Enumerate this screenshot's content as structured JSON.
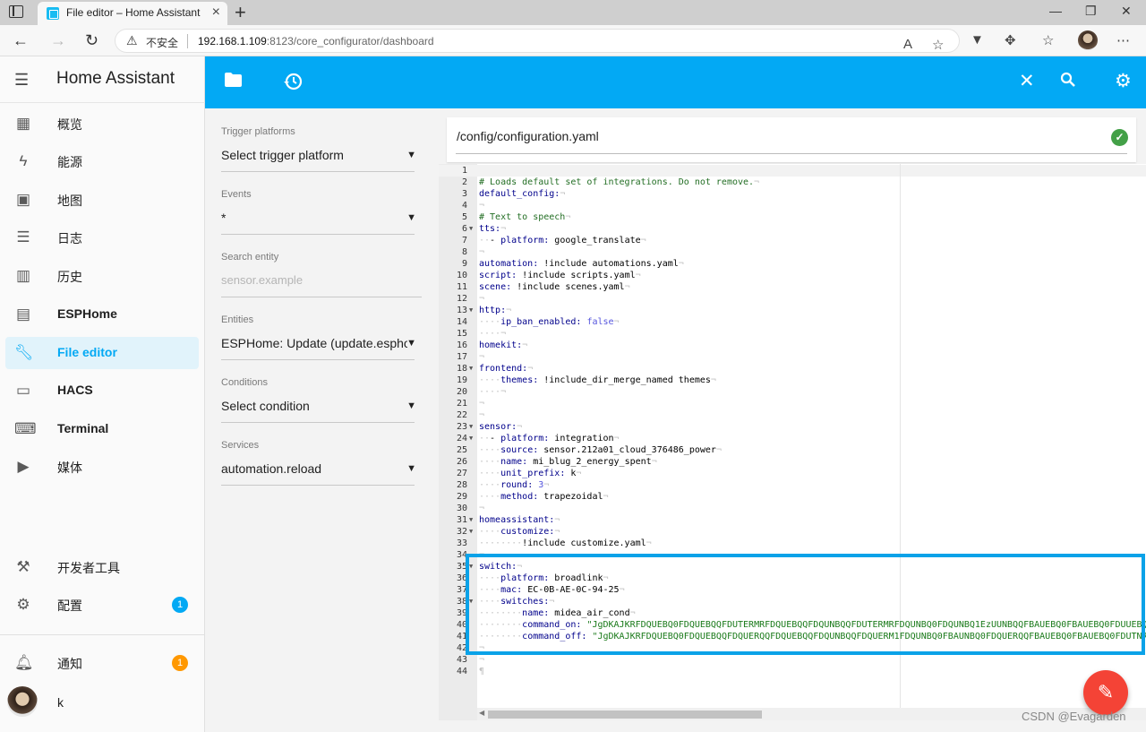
{
  "browser": {
    "tab_title": "File editor – Home Assistant",
    "insecure_label": "不安全",
    "url_host": "192.168.1.109",
    "url_rest": ":8123/core_configurator/dashboard"
  },
  "sidebar": {
    "title": "Home Assistant",
    "items": [
      {
        "label": "概览",
        "icon": "dashboard-icon"
      },
      {
        "label": "能源",
        "icon": "lightning-icon"
      },
      {
        "label": "地图",
        "icon": "map-icon"
      },
      {
        "label": "日志",
        "icon": "list-icon"
      },
      {
        "label": "历史",
        "icon": "chart-icon"
      },
      {
        "label": "ESPHome",
        "icon": "chip-icon"
      },
      {
        "label": "File editor",
        "icon": "wrench-icon"
      },
      {
        "label": "HACS",
        "icon": "hacs-icon"
      },
      {
        "label": "Terminal",
        "icon": "terminal-icon"
      },
      {
        "label": "媒体",
        "icon": "media-icon"
      }
    ],
    "dev_tools": "开发者工具",
    "settings": "配置",
    "settings_badge": "1",
    "notifications": "通知",
    "notifications_badge": "1",
    "user": "k"
  },
  "panel": {
    "trigger_label": "Trigger platforms",
    "trigger_value": "Select trigger platform",
    "events_label": "Events",
    "events_value": "*",
    "search_label": "Search entity",
    "search_placeholder": "sensor.example",
    "entities_label": "Entities",
    "entities_value": "ESPHome: Update (update.esphome",
    "conditions_label": "Conditions",
    "conditions_value": "Select condition",
    "services_label": "Services",
    "services_value": "automation.reload"
  },
  "editor": {
    "file_path": "/config/configuration.yaml"
  },
  "colors": {
    "accent": "#03a9f4",
    "fab": "#f44336",
    "ok": "#43a047",
    "badge_blue": "#03a9f4",
    "badge_orange": "#ff9800"
  },
  "watermark": "CSDN @Evagarden"
}
